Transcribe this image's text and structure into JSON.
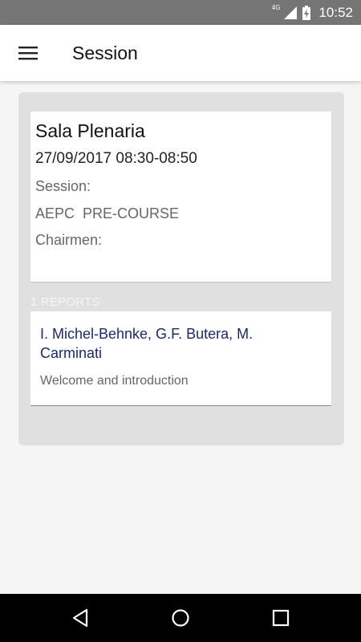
{
  "status_bar": {
    "network_type": "4G",
    "time": "10:52",
    "icons": [
      "signal-icon",
      "battery-charging-icon"
    ]
  },
  "app_bar": {
    "title": "Session",
    "menu_icon": "hamburger-menu-icon"
  },
  "session": {
    "room": "Sala Plenaria",
    "datetime": "27/09/2017 08:30-08:50",
    "session_label": "Session:",
    "session_name": "AEPC  PRE-COURSE",
    "chairmen_label": "Chairmen:"
  },
  "reports": {
    "header": "1 REPORTS",
    "items": [
      {
        "authors": "I. Michel-Behnke, G.F. Butera, M. Carminati",
        "title": "Welcome and introduction"
      }
    ]
  },
  "nav_bar": {
    "icons": [
      "back-icon",
      "home-icon",
      "recents-icon"
    ]
  }
}
